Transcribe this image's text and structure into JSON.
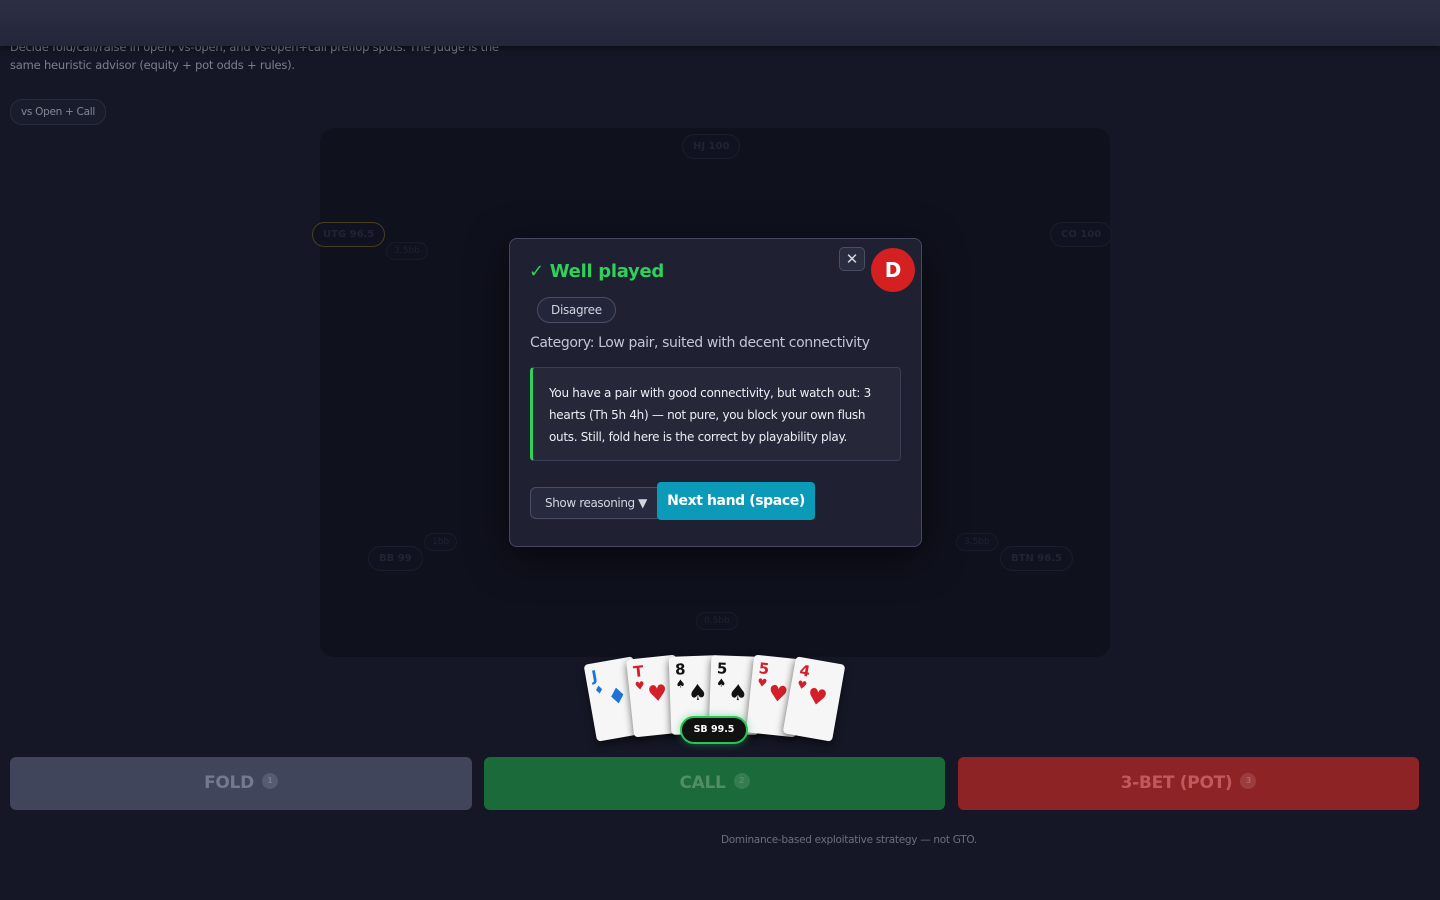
{
  "intro": {
    "line1": "Decide fold/call/raise in open, vs-open, and vs-open+call preflop spots. The judge is the",
    "line2": "same heuristic advisor (equity + pot odds + rules)."
  },
  "mode_chip": "vs Open + Call",
  "seats": {
    "hj": "HJ 100",
    "utg": "UTG 96.5",
    "utg_bet": "3.5bb",
    "co": "CO 100",
    "bb": "BB 99",
    "bb_bet": "1bb",
    "btn": "BTN 96.5",
    "btn_bet": "3.5bb",
    "sb_bet": "0.5bb"
  },
  "modal": {
    "title": "✓ Well played",
    "close": "✕",
    "avatar": "D",
    "disagree": "Disagree",
    "category": "Category: Low pair, suited with decent connectivity",
    "explanation": "You have a pair with good connectivity, but watch out: 3 hearts (Th 5h 4h) — not pure, you block your own flush outs. Still, fold here is the correct by playability play.",
    "reasoning_label": "Show reasoning ▼",
    "next_label": "Next hand (space)",
    "accent": "#2ed15a"
  },
  "hand": [
    {
      "rank": "J",
      "suit": "♦",
      "color": "blue"
    },
    {
      "rank": "T",
      "suit": "♥",
      "color": "red"
    },
    {
      "rank": "8",
      "suit": "♠",
      "color": "black"
    },
    {
      "rank": "5",
      "suit": "♠",
      "color": "black"
    },
    {
      "rank": "5",
      "suit": "♥",
      "color": "red"
    },
    {
      "rank": "4",
      "suit": "♥",
      "color": "red"
    }
  ],
  "hero_badge": "SB 99.5",
  "actions": {
    "fold": {
      "label": "FOLD",
      "key": "1"
    },
    "call": {
      "label": "CALL",
      "key": "2"
    },
    "raise": {
      "label": "3-BET (POT)",
      "key": "3"
    }
  },
  "footnote": "Dominance-based exploitative strategy — not GTO."
}
